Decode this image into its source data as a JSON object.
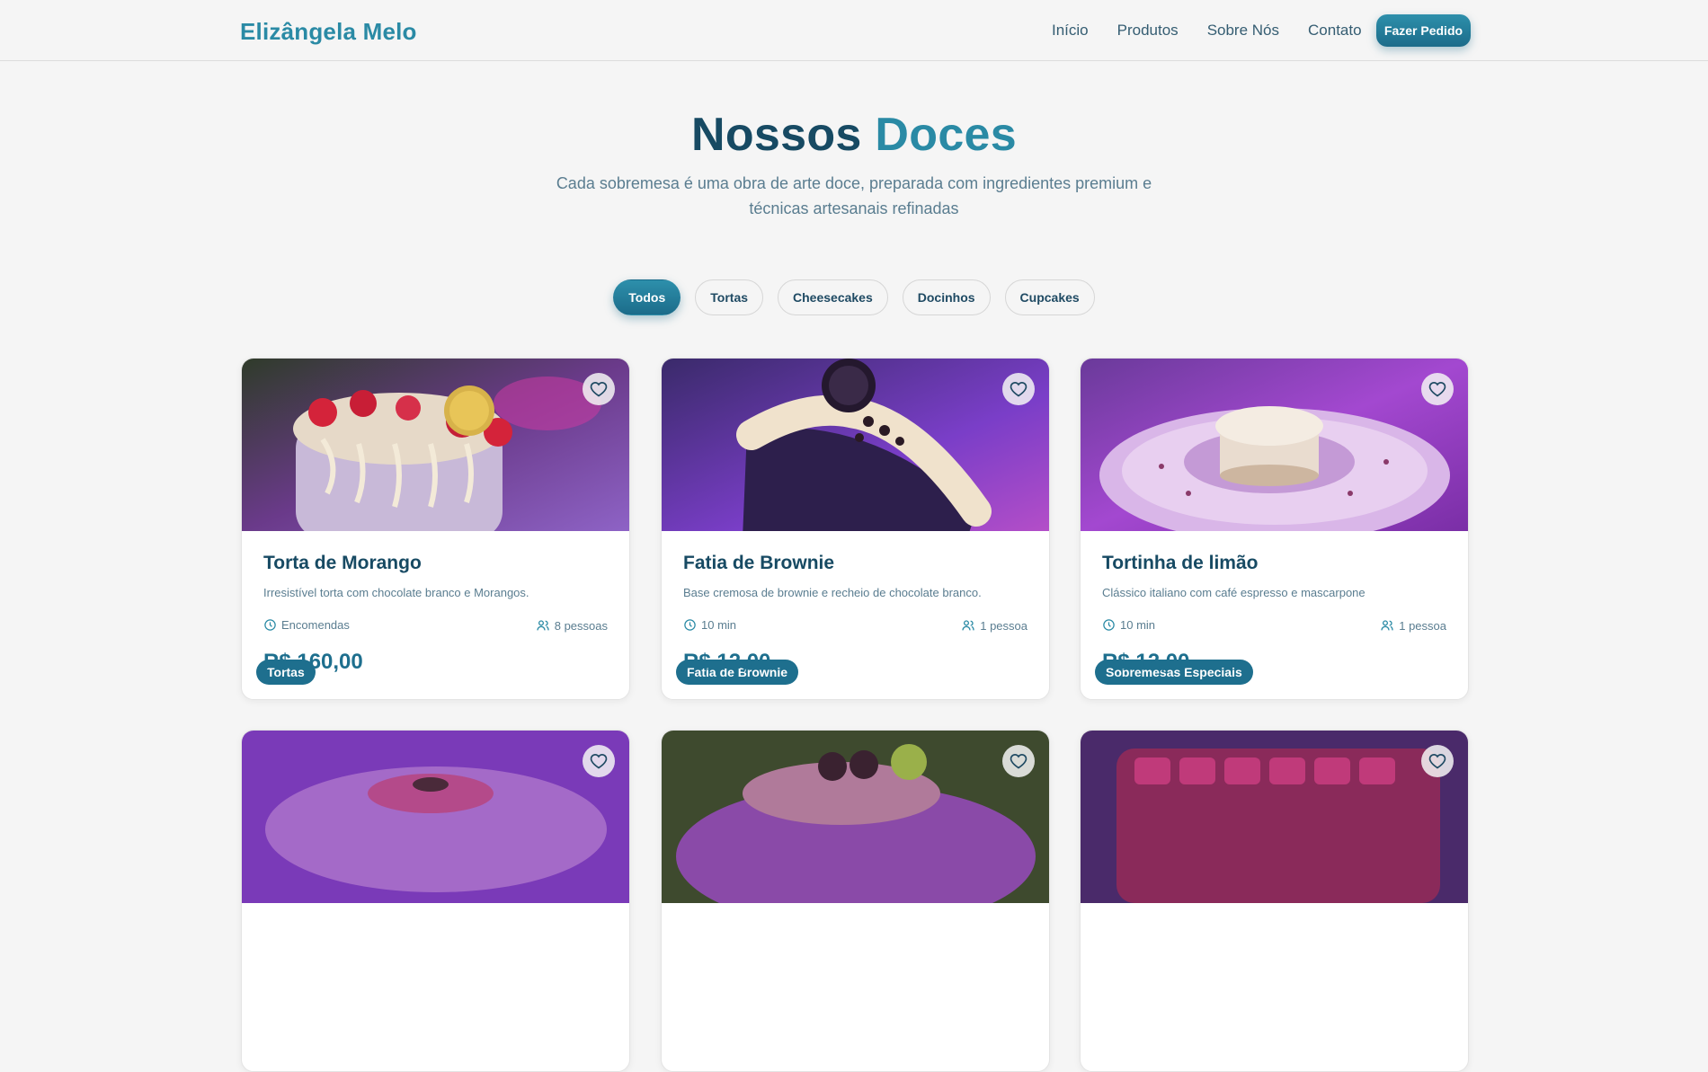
{
  "brand": "Elizângela Melo",
  "nav": {
    "links": [
      "Início",
      "Produtos",
      "Sobre Nós",
      "Contato"
    ],
    "order_button": "Fazer Pedido"
  },
  "hero": {
    "title_main": "Nossos",
    "title_accent": "Doces",
    "subtitle": "Cada sobremesa é uma obra de arte doce, preparada com ingredientes premium e técnicas artesanais refinadas"
  },
  "filters": {
    "items": [
      "Todos",
      "Tortas",
      "Cheesecakes",
      "Docinhos",
      "Cupcakes"
    ],
    "active": "Todos"
  },
  "products": [
    {
      "category": "Tortas",
      "name": "Torta de Morango",
      "description": "Irresistível torta com chocolate branco e Morangos.",
      "time": "Encomendas",
      "serves": "8 pessoas",
      "price": "R$ 160,00"
    },
    {
      "category": "Fatia de Brownie",
      "name": "Fatia de Brownie",
      "description": "Base cremosa de brownie e recheio de chocolate branco.",
      "time": "10 min",
      "serves": "1 pessoa",
      "price": "R$ 12,00"
    },
    {
      "category": "Sobremesas Especiais",
      "name": "Tortinha de limão",
      "description": "Clássico italiano com café espresso e mascarpone",
      "time": "10 min",
      "serves": "1 pessoa",
      "price": "R$ 12,00"
    },
    {},
    {},
    {}
  ],
  "icons": {
    "favorite": "heart-icon",
    "time": "clock-icon",
    "serves": "users-icon"
  },
  "colors": {
    "brand": "#2a8aa5",
    "dark": "#174a63",
    "accent_button": "#1e6f8e",
    "background": "#f5f5f5"
  }
}
